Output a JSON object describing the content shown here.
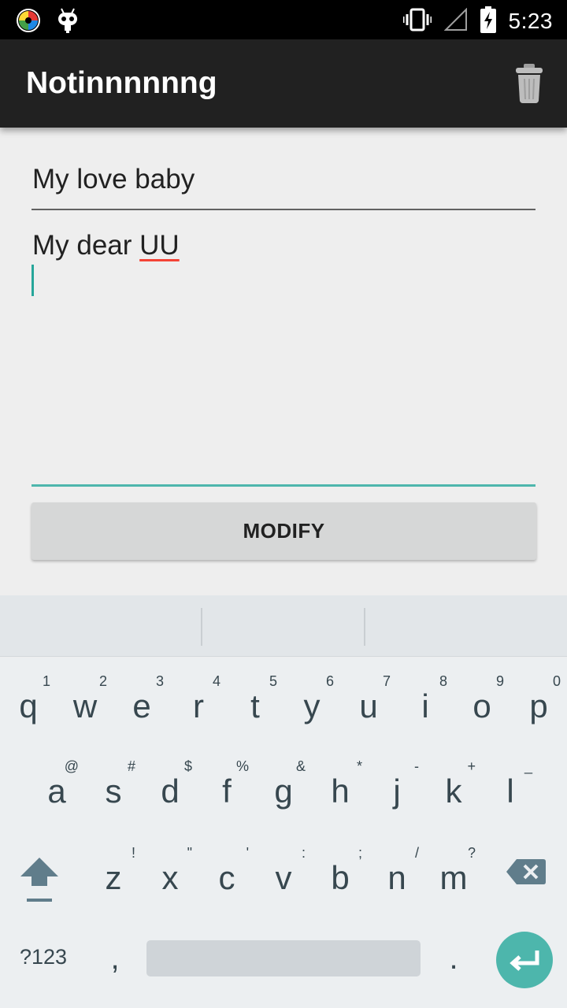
{
  "status_bar": {
    "time": "5:23",
    "icons": [
      "app-launcher-icon",
      "cyanogen-icon",
      "vibrate-icon",
      "signal-icon",
      "battery-charging-icon"
    ]
  },
  "app_bar": {
    "title": "Notinnnnnng",
    "action_icon": "trash-icon"
  },
  "note": {
    "title_value": "My love baby",
    "body_plain": "My dear ",
    "body_misspelled": "UU"
  },
  "modify_button": {
    "label": "MODIFY"
  },
  "keyboard": {
    "row1": [
      {
        "key": "q",
        "hint": "1"
      },
      {
        "key": "w",
        "hint": "2"
      },
      {
        "key": "e",
        "hint": "3"
      },
      {
        "key": "r",
        "hint": "4"
      },
      {
        "key": "t",
        "hint": "5"
      },
      {
        "key": "y",
        "hint": "6"
      },
      {
        "key": "u",
        "hint": "7"
      },
      {
        "key": "i",
        "hint": "8"
      },
      {
        "key": "o",
        "hint": "9"
      },
      {
        "key": "p",
        "hint": "0"
      }
    ],
    "row2": [
      {
        "key": "a",
        "hint": "@"
      },
      {
        "key": "s",
        "hint": "#"
      },
      {
        "key": "d",
        "hint": "$"
      },
      {
        "key": "f",
        "hint": "%"
      },
      {
        "key": "g",
        "hint": "&"
      },
      {
        "key": "h",
        "hint": "*"
      },
      {
        "key": "j",
        "hint": "-"
      },
      {
        "key": "k",
        "hint": "+"
      },
      {
        "key": "l",
        "hint": "_"
      }
    ],
    "row3": [
      {
        "key": "z",
        "hint": "!"
      },
      {
        "key": "x",
        "hint": "\""
      },
      {
        "key": "c",
        "hint": "'"
      },
      {
        "key": "v",
        "hint": ":"
      },
      {
        "key": "b",
        "hint": ";"
      },
      {
        "key": "n",
        "hint": "/"
      },
      {
        "key": "m",
        "hint": "?"
      }
    ],
    "symbols_label": "?123",
    "comma": ",",
    "period": ".",
    "accent_color": "#4db6ac"
  }
}
